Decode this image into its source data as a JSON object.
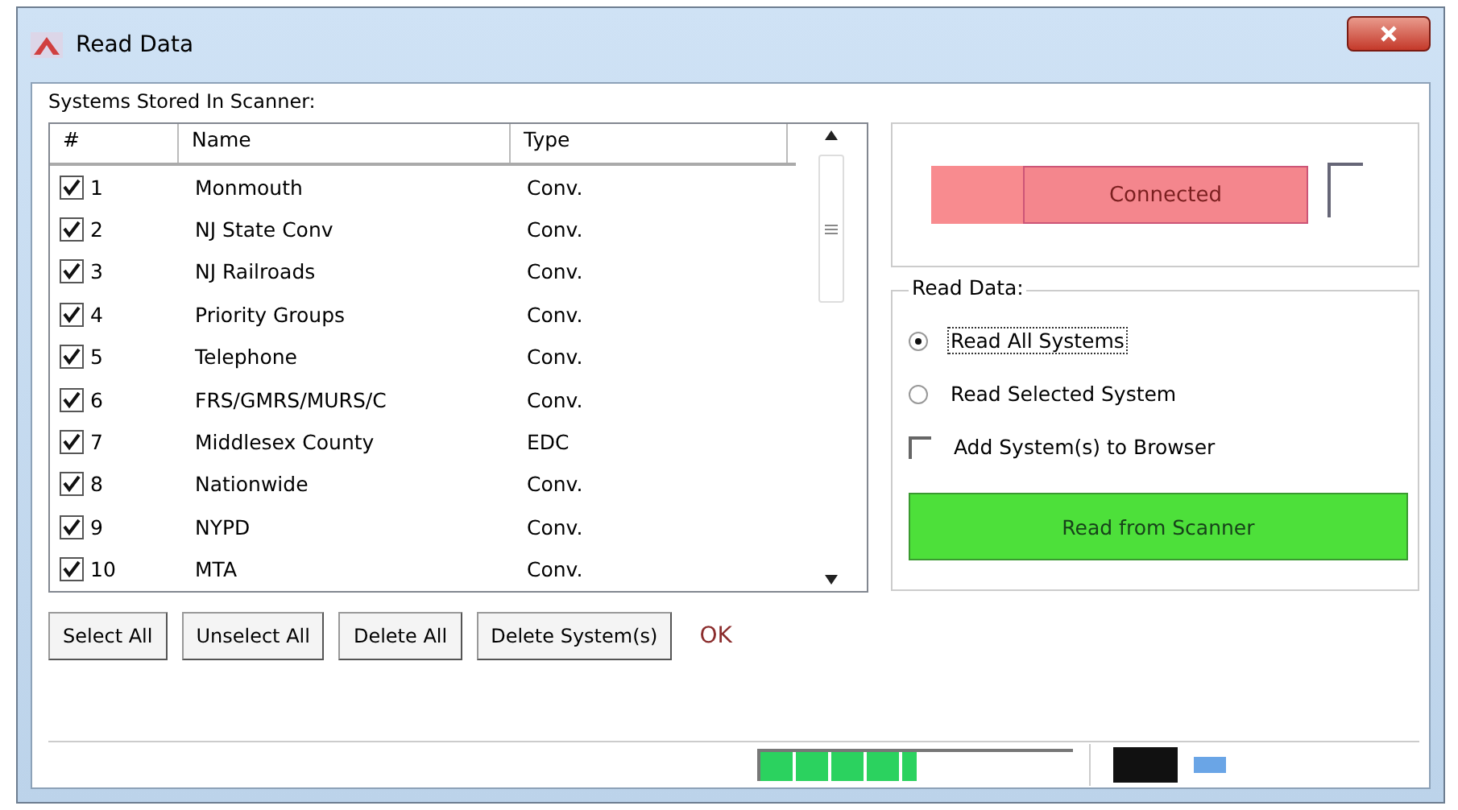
{
  "window": {
    "title": "Read Data"
  },
  "systems": {
    "label": "Systems Stored In Scanner:",
    "columns": [
      "#",
      "Name",
      "Type"
    ],
    "rows": [
      {
        "number": "1",
        "name": "Monmouth",
        "type": "Conv.",
        "checked": true
      },
      {
        "number": "2",
        "name": "NJ State Conv",
        "type": "Conv.",
        "checked": true
      },
      {
        "number": "3",
        "name": "NJ Railroads",
        "type": "Conv.",
        "checked": true
      },
      {
        "number": "4",
        "name": "Priority Groups",
        "type": "Conv.",
        "checked": true
      },
      {
        "number": "5",
        "name": "Telephone",
        "type": "Conv.",
        "checked": true
      },
      {
        "number": "6",
        "name": "FRS/GMRS/MURS/C",
        "type": "Conv.",
        "checked": true
      },
      {
        "number": "7",
        "name": "Middlesex County",
        "type": "EDC",
        "checked": true
      },
      {
        "number": "8",
        "name": "Nationwide",
        "type": "Conv.",
        "checked": true
      },
      {
        "number": "9",
        "name": "NYPD",
        "type": "Conv.",
        "checked": true
      },
      {
        "number": "10",
        "name": "MTA",
        "type": "Conv.",
        "checked": true
      }
    ],
    "buttons": [
      "Select All",
      "Unselect All",
      "Delete All",
      "Delete System(s)"
    ],
    "result": "OK"
  },
  "connection": {
    "status": "Connected",
    "checked": false
  },
  "read_data": {
    "label": "Read Data:",
    "options": [
      {
        "label": "Read All Systems",
        "selected": true
      },
      {
        "label": "Read Selected System",
        "selected": false
      }
    ],
    "add_to_browser": {
      "label": "Add System(s) to Browser",
      "checked": false
    },
    "button": "Read from Scanner"
  },
  "status_bar": {
    "progress": {
      "level": 0.5
    }
  }
}
